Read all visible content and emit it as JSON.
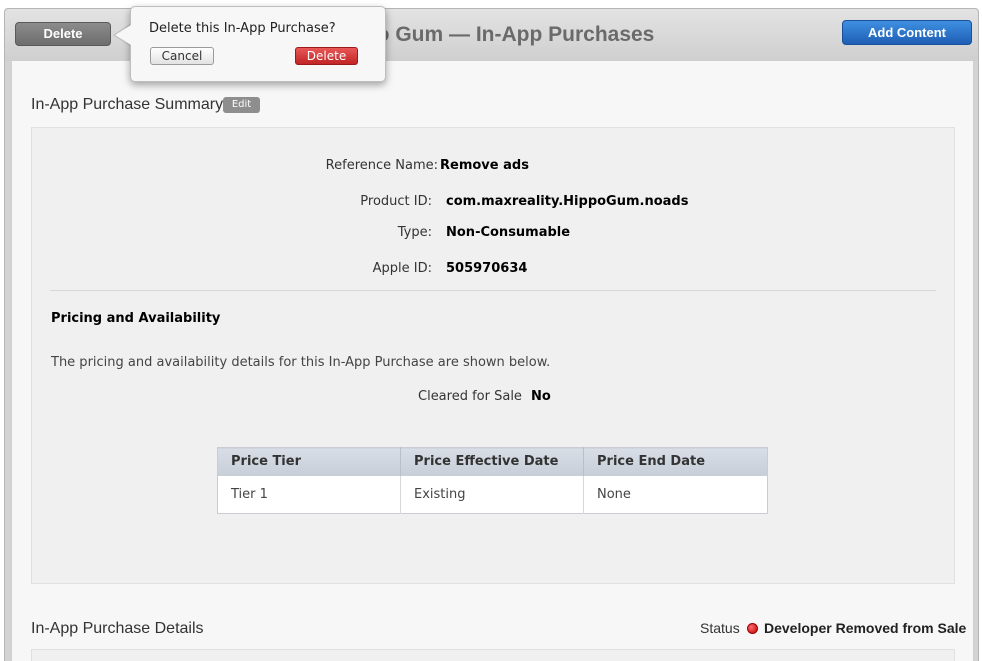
{
  "header": {
    "title": "Hippo Gum — In-App Purchases",
    "delete_label": "Delete",
    "add_content_label": "Add Content"
  },
  "popover": {
    "question": "Delete this In-App Purchase?",
    "cancel_label": "Cancel",
    "delete_label": "Delete"
  },
  "summary": {
    "title": "In-App Purchase Summary",
    "edit_label": "Edit",
    "fields": [
      {
        "label": "Reference Name:",
        "value": "Remove ads"
      },
      {
        "label": "Product ID:",
        "value": "com.maxreality.HippoGum.noads"
      },
      {
        "label": "Type:",
        "value": "Non-Consumable"
      },
      {
        "label": "Apple ID:",
        "value": "505970634"
      }
    ]
  },
  "pricing": {
    "title": "Pricing and Availability",
    "description": "The pricing and availability details for this In-App Purchase are shown below.",
    "cleared_label": "Cleared for Sale",
    "cleared_value": "No",
    "table": {
      "headers": [
        "Price Tier",
        "Price Effective Date",
        "Price End Date"
      ],
      "rows": [
        [
          "Tier 1",
          "Existing",
          "None"
        ]
      ]
    }
  },
  "details": {
    "title": "In-App Purchase Details",
    "status_label": "Status",
    "status_value": "Developer Removed from Sale",
    "status_color": "#cc0000"
  }
}
